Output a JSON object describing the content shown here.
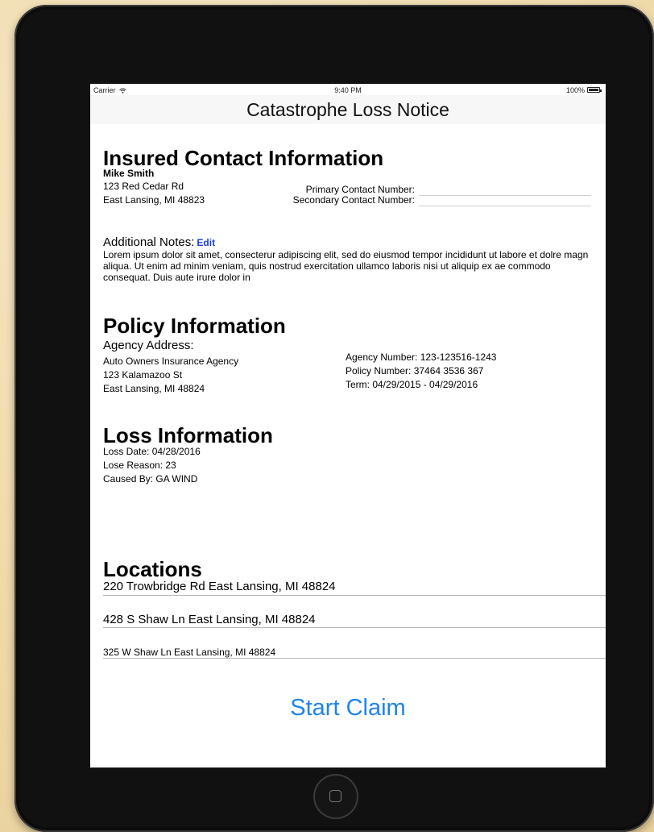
{
  "status_bar": {
    "carrier": "Carrier",
    "wifi_icon": "wifi-icon",
    "time": "9:40 PM",
    "battery": "100%"
  },
  "nav": {
    "title": "Catastrophe Loss Notice"
  },
  "insured": {
    "heading": "Insured Contact Information",
    "name": "Mike Smith",
    "street": "123 Red Cedar Rd",
    "city_state": "East Lansing, MI 48823",
    "primary_label": "Primary Contact Number:",
    "primary_value": "",
    "secondary_label": "Secondary Contact Number:",
    "secondary_value": ""
  },
  "notes": {
    "label": "Additional Notes:",
    "edit": "Edit",
    "text": "Lorem ipsum dolor sit amet, consecterur adipiscing elit, sed do eiusmod tempor incididunt ut labore et dolre magn aliqua. Ut enim ad minim veniam, quis nostrud exercitation ullamco laboris nisi ut aliquip ex ae commodo consequat. Duis aute irure dolor in"
  },
  "policy": {
    "heading": "Policy Information",
    "agency_label": "Agency Address:",
    "agency_name": "Auto Owners Insurance Agency",
    "agency_street": "123 Kalamazoo St",
    "agency_city": "East Lansing, MI 48824",
    "agency_number": "Agency Number: 123-123516-1243",
    "policy_number": "Policy Number: 37464 3536 367",
    "term": "Term: 04/29/2015 - 04/29/2016"
  },
  "loss": {
    "heading": "Loss Information",
    "date": "Loss Date: 04/28/2016",
    "reason": "Lose Reason: 23",
    "caused_by": "Caused By: GA WIND"
  },
  "locations": {
    "heading": "Locations",
    "items": [
      "220 Trowbridge Rd East Lansing, MI 48824",
      "428 S Shaw Ln East Lansing, MI 48824",
      "325 W Shaw Ln East Lansing, MI 48824"
    ]
  },
  "actions": {
    "start_claim": "Start Claim"
  },
  "colors": {
    "link": "#1a3fd6",
    "button": "#1f84e8",
    "background": "#f1dfb6",
    "device": "#111111"
  },
  "device": {
    "home_icon": "home-button-icon"
  }
}
